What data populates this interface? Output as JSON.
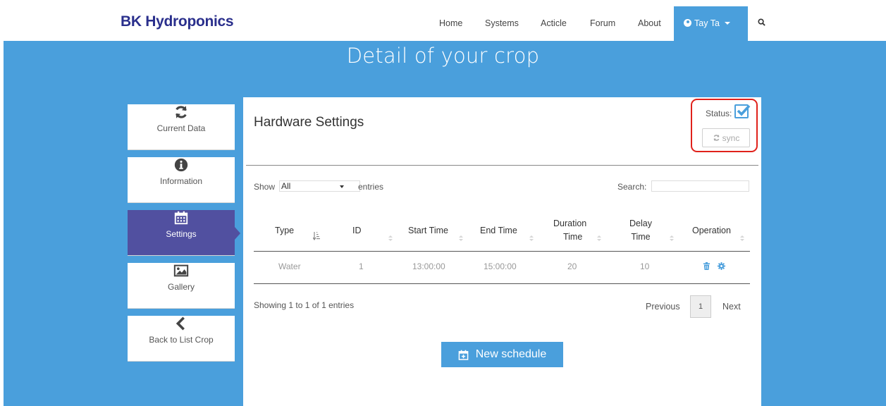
{
  "app": {
    "brand": "BK Hydroponics"
  },
  "nav": {
    "items": [
      "Home",
      "Systems",
      "Acticle",
      "Forum",
      "About"
    ],
    "user": "Tay Ta"
  },
  "hero": {
    "title": "Detail of your crop"
  },
  "sidebar": {
    "items": [
      {
        "label": "Current Data",
        "icon": "refresh-icon"
      },
      {
        "label": "Information",
        "icon": "info-icon"
      },
      {
        "label": "Settings",
        "icon": "calendar-icon",
        "active": true
      },
      {
        "label": "Gallery",
        "icon": "image-icon"
      },
      {
        "label": "Back to List Crop",
        "icon": "chevron-left-icon"
      }
    ]
  },
  "panel": {
    "title": "Hardware Settings",
    "status_label": "Status:",
    "status_checked": true,
    "sync_label": "sync"
  },
  "table_controls": {
    "show_label": "Show",
    "show_value": "All",
    "entries_label": "entries",
    "search_label": "Search:"
  },
  "table": {
    "headers": [
      {
        "line1": "Type",
        "line2": ""
      },
      {
        "line1": "ID",
        "line2": ""
      },
      {
        "line1": "Start Time",
        "line2": ""
      },
      {
        "line1": "End Time",
        "line2": ""
      },
      {
        "line1": "Duration",
        "line2": "Time"
      },
      {
        "line1": "Delay",
        "line2": "Time"
      },
      {
        "line1": "Operation",
        "line2": ""
      }
    ],
    "rows": [
      {
        "type": "Water",
        "id": "1",
        "start": "13:00:00",
        "end": "15:00:00",
        "duration": "20",
        "delay": "10"
      }
    ]
  },
  "pagination": {
    "info": "Showing 1 to 1 of 1 entries",
    "previous": "Previous",
    "page": "1",
    "next": "Next"
  },
  "actions": {
    "new_schedule": "New schedule"
  },
  "colors": {
    "brand": "#2a2f8c",
    "primary": "#4a9fdc",
    "sidebar_active": "#5150a0",
    "highlight": "#e0211b"
  }
}
